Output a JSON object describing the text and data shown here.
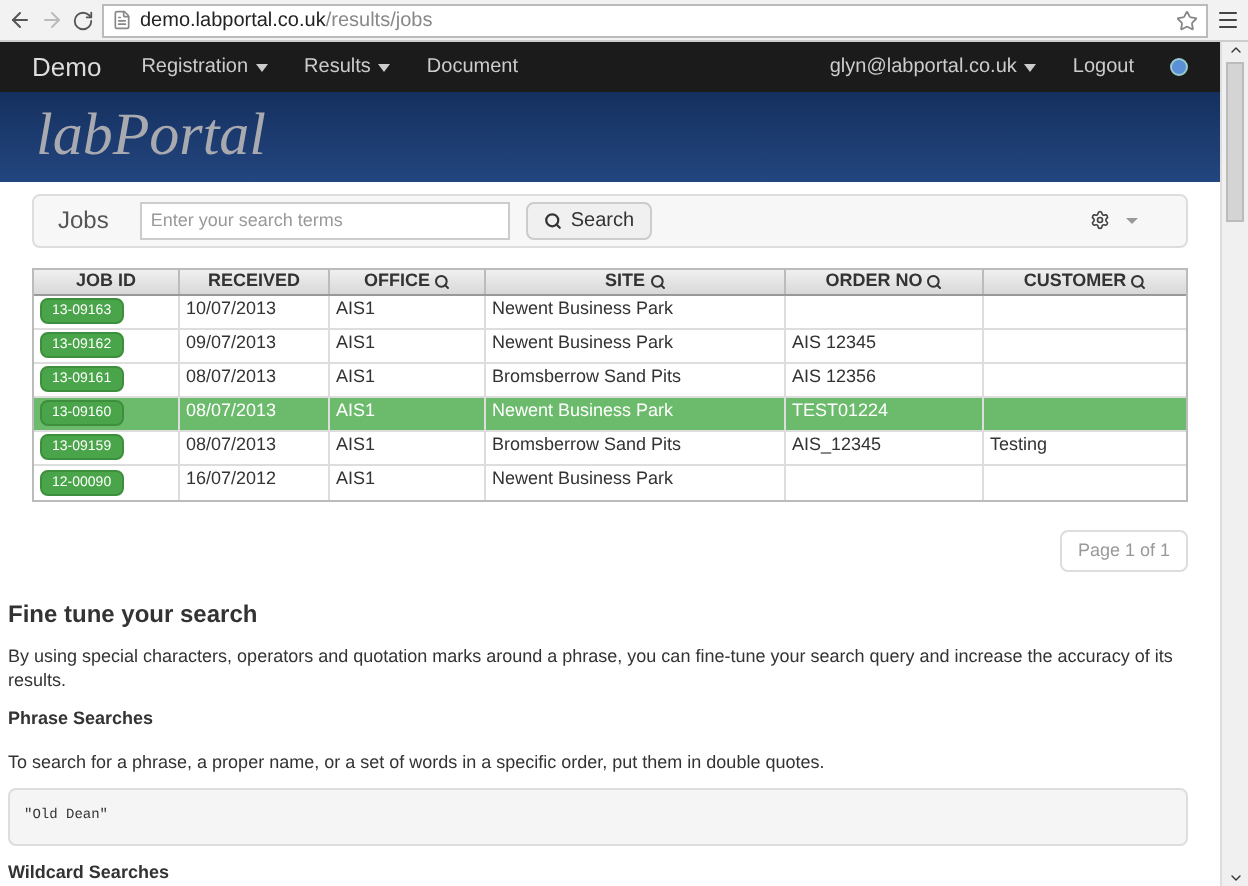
{
  "browser": {
    "url_host": "demo.labportal.co.uk",
    "url_path": "/results/jobs"
  },
  "navbar": {
    "brand": "Demo",
    "items": [
      {
        "label": "Registration",
        "dropdown": true
      },
      {
        "label": "Results",
        "dropdown": true
      },
      {
        "label": "Document",
        "dropdown": false
      }
    ],
    "user": {
      "label": "glyn@labportal.co.uk",
      "dropdown": true
    },
    "logout": "Logout"
  },
  "banner": {
    "logo": "labPortal"
  },
  "search_panel": {
    "title": "Jobs",
    "placeholder": "Enter your search terms",
    "button": "Search"
  },
  "table": {
    "columns": [
      {
        "label": "JOB ID",
        "searchable": false
      },
      {
        "label": "RECEIVED",
        "searchable": false
      },
      {
        "label": "OFFICE",
        "searchable": true
      },
      {
        "label": "SITE",
        "searchable": true
      },
      {
        "label": "ORDER NO",
        "searchable": true
      },
      {
        "label": "CUSTOMER",
        "searchable": true
      }
    ],
    "rows": [
      {
        "job_id": "13-09163",
        "received": "10/07/2013",
        "office": "AIS1",
        "site": "Newent Business Park",
        "order_no": "",
        "customer": "",
        "selected": false
      },
      {
        "job_id": "13-09162",
        "received": "09/07/2013",
        "office": "AIS1",
        "site": "Newent Business Park",
        "order_no": "AIS 12345",
        "customer": "",
        "selected": false
      },
      {
        "job_id": "13-09161",
        "received": "08/07/2013",
        "office": "AIS1",
        "site": "Bromsberrow Sand Pits",
        "order_no": "AIS 12356",
        "customer": "",
        "selected": false
      },
      {
        "job_id": "13-09160",
        "received": "08/07/2013",
        "office": "AIS1",
        "site": "Newent Business Park",
        "order_no": "TEST01224",
        "customer": "",
        "selected": true
      },
      {
        "job_id": "13-09159",
        "received": "08/07/2013",
        "office": "AIS1",
        "site": "Bromsberrow Sand Pits",
        "order_no": "AIS_12345",
        "customer": "Testing",
        "selected": false
      },
      {
        "job_id": "12-00090",
        "received": "16/07/2012",
        "office": "AIS1",
        "site": "Newent Business Park",
        "order_no": "",
        "customer": "",
        "selected": false
      }
    ]
  },
  "pagination": "Page 1 of 1",
  "help": {
    "title": "Fine tune your search",
    "intro": "By using special characters, operators and quotation marks around a phrase, you can fine-tune your search query and increase the accuracy of its results.",
    "sections": [
      {
        "heading": "Phrase Searches",
        "text": "To search for a phrase, a proper name, or a set of words in a specific order, put them in double quotes.",
        "example": "\"Old Dean\""
      },
      {
        "heading": "Wildcard Searches"
      }
    ]
  }
}
